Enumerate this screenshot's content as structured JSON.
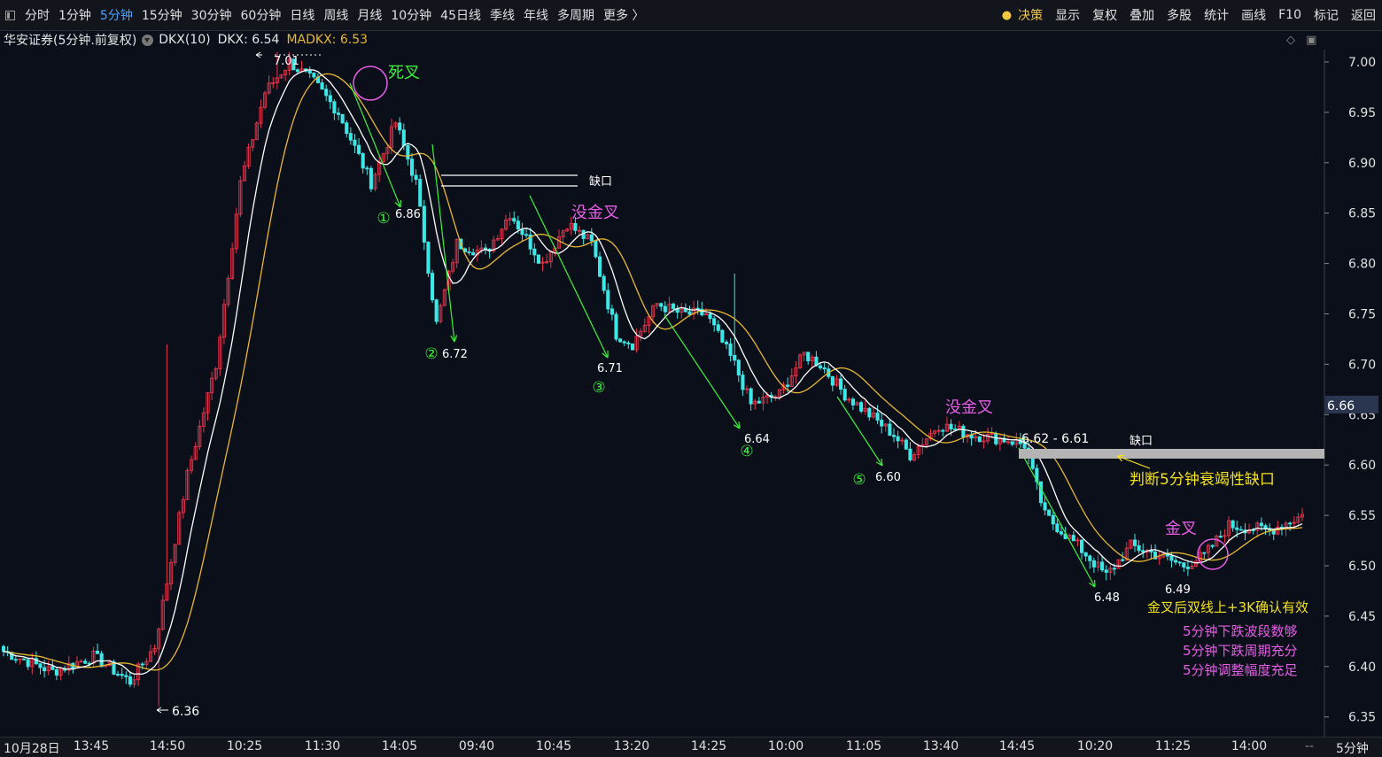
{
  "topbar": {
    "tabs": [
      "分时",
      "1分钟",
      "5分钟",
      "15分钟",
      "30分钟",
      "60分钟",
      "日线",
      "周线",
      "月线",
      "10分钟",
      "45日线",
      "季线",
      "年线",
      "多周期",
      "更多 〉"
    ],
    "active_tab": "5分钟",
    "right_items": [
      "决策",
      "显示",
      "复权",
      "叠加",
      "多股",
      "统计",
      "画线",
      "F10",
      "标记",
      "返回"
    ]
  },
  "infobar": {
    "title": "华安证券(5分钟.前复权)",
    "indicator": "DKX(10)",
    "dkx": "DKX: 6.54",
    "madkx": "MADKX: 6.53"
  },
  "colors": {
    "up": "#e8334a",
    "down": "#3ee6e6",
    "dkx": "#ffffff",
    "madkx": "#e8b832",
    "green": "#3af23a",
    "pink": "#e65ce6",
    "yellow": "#f2e21a"
  },
  "price_axis": {
    "ticks": [
      "7.00",
      "6.95",
      "6.90",
      "6.85",
      "6.80",
      "6.75",
      "6.70",
      "6.65",
      "6.60",
      "6.55",
      "6.50",
      "6.45",
      "6.40",
      "6.35"
    ],
    "current": "6.66"
  },
  "time_axis": {
    "first": "10月28日",
    "ticks": [
      "13:45",
      "14:50",
      "10:25",
      "11:30",
      "14:05",
      "09:40",
      "10:45",
      "13:20",
      "14:25",
      "10:00",
      "11:05",
      "13:40",
      "14:45",
      "10:20",
      "11:25",
      "14:00"
    ],
    "dash": "--",
    "period": "5分钟"
  },
  "annotations": {
    "death_cross": "死叉",
    "no_golden_1": "没金叉",
    "no_golden_2": "没金叉",
    "golden_cross": "金叉",
    "gap_1": "缺口",
    "gap_2": "缺口",
    "gap_range": "6.62 - 6.61",
    "gap_note": "判断5分钟衰竭性缺口",
    "confirm_note": "金叉后双线上+3K确认有效",
    "notes": [
      "5分钟下跌波段数够",
      "5分钟下跌周期充分",
      "5分钟调整幅度充足"
    ]
  },
  "wave_labels": [
    {
      "num": "①",
      "price": "6.86"
    },
    {
      "num": "②",
      "price": "6.72"
    },
    {
      "num": "③",
      "price": "6.71"
    },
    {
      "num": "④",
      "price": "6.64"
    },
    {
      "num": "⑤",
      "price": "6.60"
    }
  ],
  "price_labels": {
    "high": "7.01",
    "low": "6.36",
    "low2": "6.48",
    "low3": "6.49"
  },
  "chart_data": {
    "type": "candlestick",
    "ylim": [
      6.33,
      7.02
    ],
    "y_ticks": [
      7.0,
      6.95,
      6.9,
      6.85,
      6.8,
      6.75,
      6.7,
      6.65,
      6.6,
      6.55,
      6.5,
      6.45,
      6.4,
      6.35
    ],
    "key_prices": {
      "high": 7.01,
      "low": 6.36,
      "wave1": 6.86,
      "wave2": 6.72,
      "wave3": 6.71,
      "wave4": 6.64,
      "wave5": 6.6,
      "low2": 6.48,
      "low3": 6.49,
      "gap_top": 6.62,
      "gap_bottom": 6.61,
      "current": 6.66
    },
    "dkx_last": 6.54,
    "madkx_last": 6.53
  }
}
